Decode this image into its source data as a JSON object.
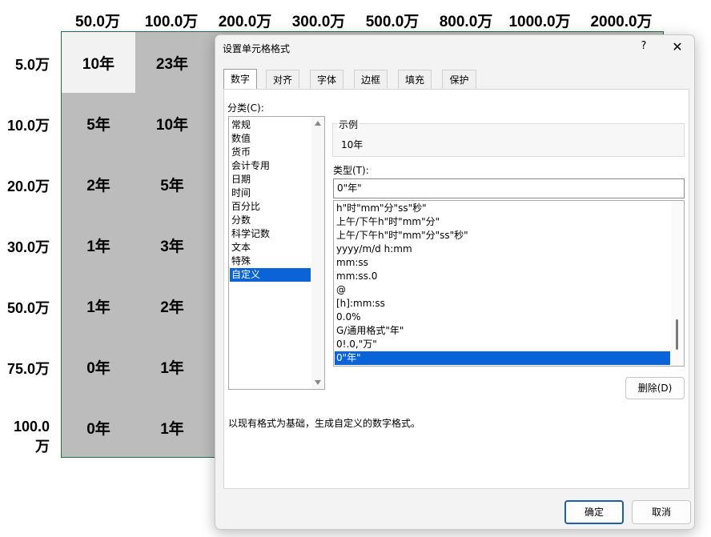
{
  "sheet": {
    "column_headers": [
      "50.0万",
      "100.0万",
      "200.0万",
      "300.0万",
      "500.0万",
      "800.0万",
      "1000.0万",
      "2000.0万"
    ],
    "row_headers": [
      "5.0万",
      "10.0万",
      "20.0万",
      "30.0万",
      "50.0万",
      "75.0万",
      "100.0万"
    ],
    "visible_cells": [
      [
        "10年",
        "23年"
      ],
      [
        "5年",
        "10年"
      ],
      [
        "2年",
        "5年"
      ],
      [
        "1年",
        "3年"
      ],
      [
        "1年",
        "2年"
      ],
      [
        "0年",
        "1年"
      ],
      [
        "0年",
        "1年"
      ]
    ],
    "colors": {
      "grid_border": "#1e7145",
      "cell_fill": "#bcbcbc",
      "active_cell": "#f2f2f2"
    }
  },
  "dialog": {
    "title": "设置单元格格式",
    "help": "?",
    "close": "✕",
    "tabs": [
      "数字",
      "对齐",
      "字体",
      "边框",
      "填充",
      "保护"
    ],
    "active_tab": "数字",
    "category_label": "分类(C):",
    "categories": [
      "常规",
      "数值",
      "货币",
      "会计专用",
      "日期",
      "时间",
      "百分比",
      "分数",
      "科学记数",
      "文本",
      "特殊",
      "自定义"
    ],
    "selected_category": "自定义",
    "sample_label": "示例",
    "sample_value": "10年",
    "type_label": "类型(T):",
    "type_value": "0\"年\"",
    "format_list": [
      "h\"时\"mm\"分\"ss\"秒\"",
      "上午/下午h\"时\"mm\"分\"",
      "上午/下午h\"时\"mm\"分\"ss\"秒\"",
      "yyyy/m/d h:mm",
      "mm:ss",
      "mm:ss.0",
      "@",
      "[h]:mm:ss",
      "0.0%",
      "G/通用格式\"年\"",
      "0!.0,\"万\"",
      "0\"年\""
    ],
    "selected_format": "0\"年\"",
    "delete_button": "删除(D)",
    "description": "以现有格式为基础，生成自定义的数字格式。",
    "ok_button": "确定",
    "cancel_button": "取消",
    "colors": {
      "selection": "#0a64d8",
      "primary_border": "#1a5fb4"
    }
  }
}
